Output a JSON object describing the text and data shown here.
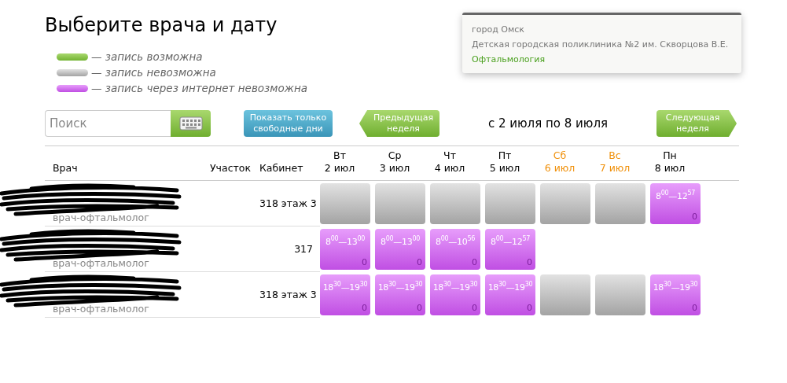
{
  "title": "Выберите врача и дату",
  "legend": [
    {
      "kind": "available",
      "label": "— запись возможна"
    },
    {
      "kind": "unavailable",
      "label": "— запись невозможна"
    },
    {
      "kind": "internet",
      "label": "— запись через интернет невозможна"
    }
  ],
  "info": {
    "city": "город Омск",
    "clinic": "Детская городская поликлиника №2 им. Скворцова В.Е.",
    "department": "Офтальмология"
  },
  "search": {
    "placeholder": "Поиск"
  },
  "free_days_button": "Показать только свободные дни",
  "prev_button": "Предыдущая неделя",
  "range": "с 2 июля по 8 июля",
  "next_button": "Следующая неделя",
  "columns": {
    "doctor": "Врач",
    "area": "Участок",
    "room": "Кабинет"
  },
  "days": [
    {
      "weekday": "Вт",
      "date": "2 июл",
      "weekend": false
    },
    {
      "weekday": "Ср",
      "date": "3 июл",
      "weekend": false
    },
    {
      "weekday": "Чт",
      "date": "4 июл",
      "weekend": false
    },
    {
      "weekday": "Пт",
      "date": "5 июл",
      "weekend": false
    },
    {
      "weekday": "Сб",
      "date": "6 июл",
      "weekend": true
    },
    {
      "weekday": "Вс",
      "date": "7 июл",
      "weekend": true
    },
    {
      "weekday": "Пн",
      "date": "8 июл",
      "weekend": false
    }
  ],
  "rows": [
    {
      "specialty": "врач-офтальмолог",
      "room": "318 этаж 3",
      "slots": [
        {
          "kind": "unavailable"
        },
        {
          "kind": "unavailable"
        },
        {
          "kind": "unavailable"
        },
        {
          "kind": "unavailable"
        },
        {
          "kind": "unavailable"
        },
        {
          "kind": "unavailable"
        },
        {
          "kind": "internet",
          "time": "8$^{00}$—12$^{57}$",
          "count": "0"
        }
      ]
    },
    {
      "specialty": "врач-офтальмолог",
      "room": "317",
      "slots": [
        {
          "kind": "internet",
          "time": "8$^{00}$—13$^{00}$",
          "count": "0"
        },
        {
          "kind": "internet",
          "time": "8$^{00}$—13$^{00}$",
          "count": "0"
        },
        {
          "kind": "internet",
          "time": "8$^{00}$—10$^{56}$",
          "count": "0"
        },
        {
          "kind": "internet",
          "time": "8$^{00}$—12$^{57}$",
          "count": "0"
        },
        {
          "kind": "empty"
        },
        {
          "kind": "empty"
        },
        {
          "kind": "empty"
        }
      ]
    },
    {
      "specialty": "врач-офтальмолог",
      "room": "318 этаж 3",
      "slots": [
        {
          "kind": "internet",
          "time": "18$^{30}$—19$^{30}$",
          "count": "0"
        },
        {
          "kind": "internet",
          "time": "18$^{30}$—19$^{30}$",
          "count": "0"
        },
        {
          "kind": "internet",
          "time": "18$^{30}$—19$^{30}$",
          "count": "0"
        },
        {
          "kind": "internet",
          "time": "18$^{30}$—19$^{30}$",
          "count": "0"
        },
        {
          "kind": "unavailable"
        },
        {
          "kind": "unavailable"
        },
        {
          "kind": "internet",
          "time": "18$^{30}$—19$^{30}$",
          "count": "0"
        }
      ]
    }
  ]
}
